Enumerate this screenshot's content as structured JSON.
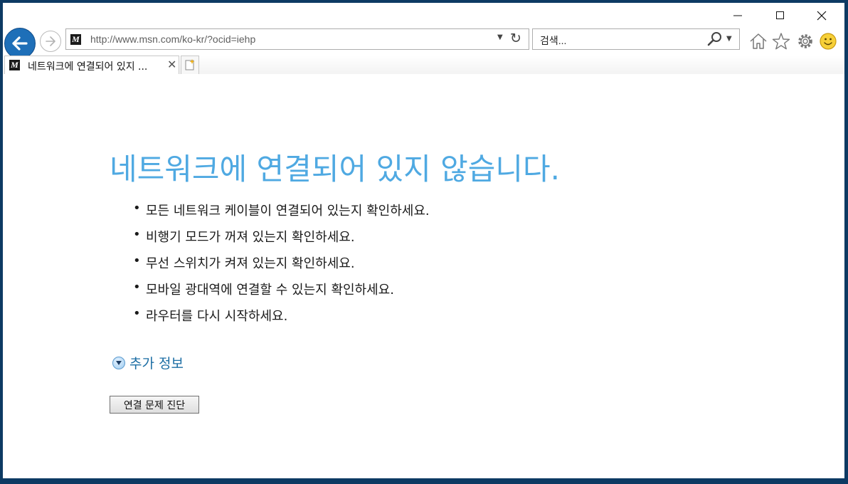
{
  "browser": {
    "address": {
      "url": "http://www.msn.com/ko-kr/?ocid=iehp",
      "favicon_label": "M"
    },
    "search": {
      "placeholder": "검색..."
    },
    "tab": {
      "title": "네트워크에 연결되어 있지 ...",
      "favicon_label": "M"
    },
    "icons": [
      "back-icon",
      "forward-icon",
      "refresh-icon",
      "search-icon",
      "home-icon",
      "favorites-star-icon",
      "gear-icon",
      "smiley-icon",
      "close-icon",
      "new-tab-icon"
    ],
    "colors": {
      "back_button": "#1e6fb8",
      "heading": "#4fa9e2",
      "link": "#1c6ea4"
    }
  },
  "page": {
    "heading": "네트워크에 연결되어 있지 않습니다.",
    "tips": [
      "모든 네트워크 케이블이 연결되어 있는지 확인하세요.",
      "비행기 모드가 꺼져 있는지 확인하세요.",
      "무선 스위치가 켜져 있는지 확인하세요.",
      "모바일 광대역에 연결할 수 있는지 확인하세요.",
      "라우터를 다시 시작하세요."
    ],
    "more_info": "추가 정보",
    "diagnose_button": "연결 문제 진단"
  }
}
